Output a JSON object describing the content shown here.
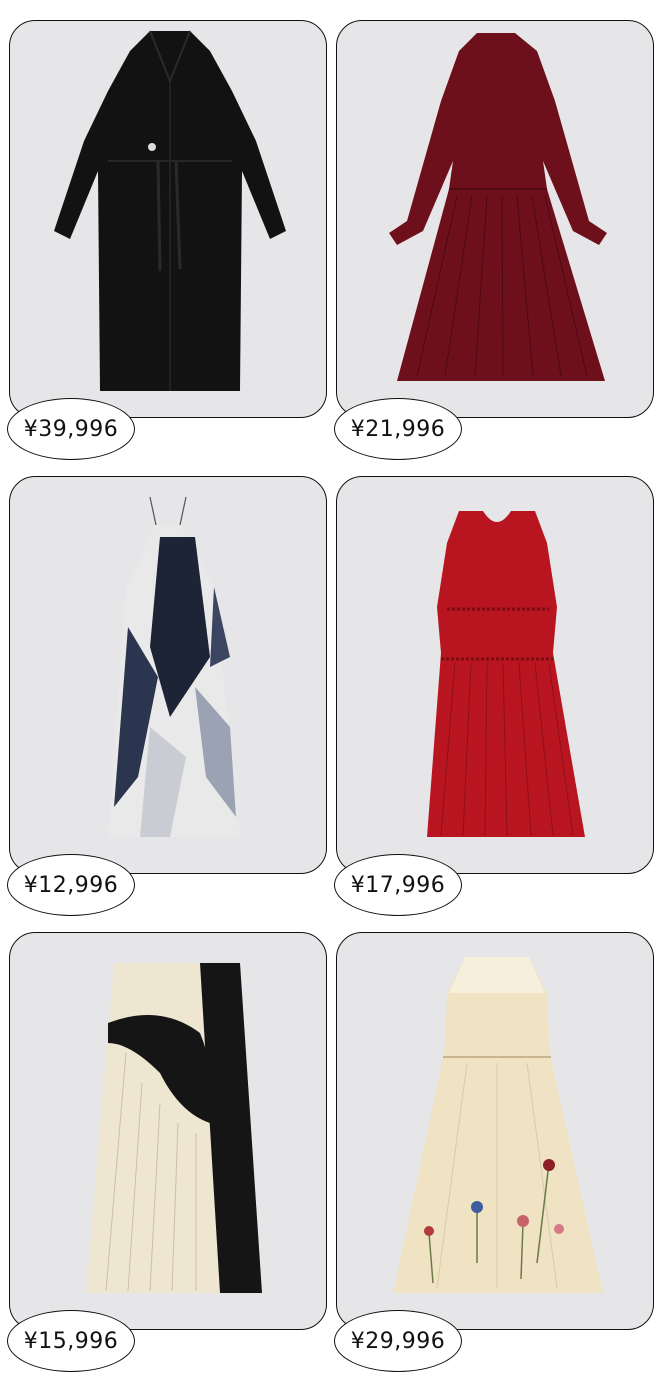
{
  "products": [
    {
      "price": "¥39,996",
      "item": "black coat"
    },
    {
      "price": "¥21,996",
      "item": "burgundy pleated dress"
    },
    {
      "price": "¥12,996",
      "item": "printed slip dress"
    },
    {
      "price": "¥17,996",
      "item": "red pleated dress"
    },
    {
      "price": "¥15,996",
      "item": "pleated skirt"
    },
    {
      "price": "¥29,996",
      "item": "cream floral dress"
    }
  ],
  "colors": {
    "card_bg": "#e6e6e8",
    "outline": "#111111",
    "coat": "#111111",
    "burgundy": "#6e0f1c",
    "red": "#b81520",
    "cream": "#efe6d2",
    "navy": "#1d2436"
  }
}
